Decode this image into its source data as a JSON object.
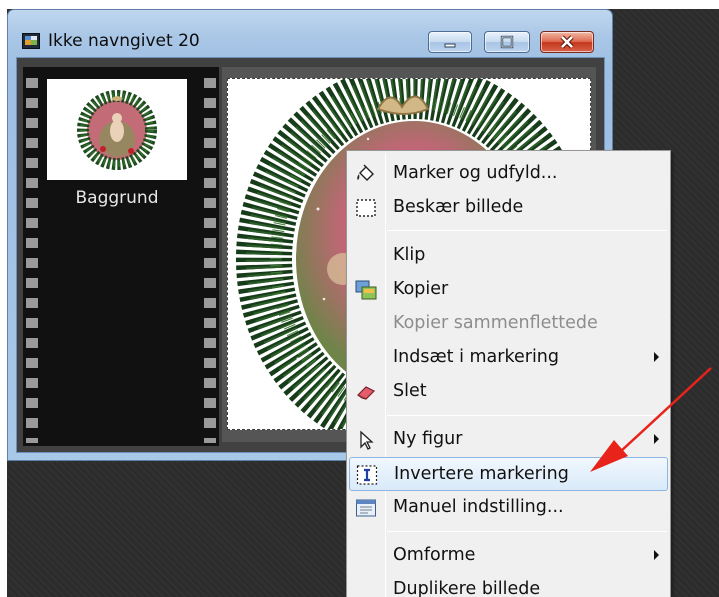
{
  "window": {
    "title": "Ikke navngivet 20",
    "buttons": [
      "minimize",
      "maximize",
      "close"
    ]
  },
  "layers": {
    "items": [
      {
        "label": "Baggrund"
      }
    ]
  },
  "context_menu": {
    "items": [
      {
        "label": "Marker og udfyld...",
        "icon": "fill-bucket-icon",
        "enabled": true,
        "submenu": false
      },
      {
        "label": "Beskær billede",
        "icon": "crop-selection-icon",
        "enabled": true,
        "submenu": false
      },
      {
        "label": "Klip",
        "icon": "",
        "enabled": true,
        "submenu": false
      },
      {
        "label": "Kopier",
        "icon": "copy-images-icon",
        "enabled": true,
        "submenu": false
      },
      {
        "label": "Kopier sammenflettede",
        "icon": "",
        "enabled": false,
        "submenu": false
      },
      {
        "label": "Indsæt i markering",
        "icon": "",
        "enabled": true,
        "submenu": true
      },
      {
        "label": "Slet",
        "icon": "eraser-icon",
        "enabled": true,
        "submenu": false
      },
      {
        "label": "Ny figur",
        "icon": "pointer-icon",
        "enabled": true,
        "submenu": true
      },
      {
        "label": "Invertere markering",
        "icon": "invert-selection-icon",
        "enabled": true,
        "submenu": false,
        "highlighted": true
      },
      {
        "label": "Manuel indstilling...",
        "icon": "manual-settings-icon",
        "enabled": true,
        "submenu": false
      },
      {
        "label": "Omforme",
        "icon": "",
        "enabled": true,
        "submenu": true
      },
      {
        "label": "Duplikere billede",
        "icon": "",
        "enabled": true,
        "submenu": false
      }
    ]
  },
  "annotation": {
    "color": "#e8231c"
  }
}
